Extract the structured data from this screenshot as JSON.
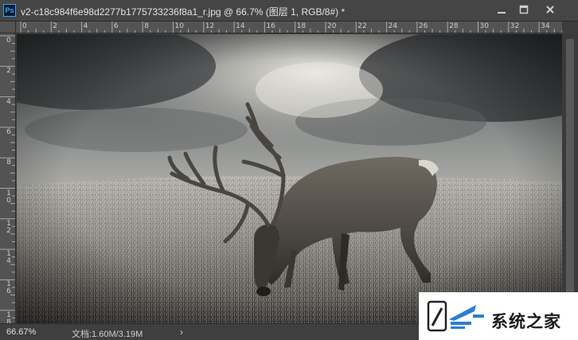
{
  "window": {
    "app_badge": "Ps",
    "title": "v2-c18c984f6e98d2277b1775733236f8a1_r.jpg @ 66.7% (图层 1, RGB/8#) *"
  },
  "rulers": {
    "top_labels": [
      "0",
      "2",
      "4",
      "6",
      "8",
      "10",
      "12",
      "14",
      "16",
      "18",
      "20",
      "22",
      "24",
      "26",
      "28",
      "30",
      "32",
      "34"
    ],
    "left_labels": [
      "0",
      "2",
      "4",
      "6",
      "8",
      "10",
      "12",
      "14",
      "16",
      "18"
    ]
  },
  "status": {
    "zoom": "66.67%",
    "doc_size": "文档:1.60M/3.19M",
    "arrow": "›"
  },
  "watermark": {
    "text": "系统之家"
  },
  "colors": {
    "ps_blue": "#31a8ff",
    "panel": "#454545",
    "ruler": "#535353",
    "watermark_blue": "#2a7fd4"
  }
}
